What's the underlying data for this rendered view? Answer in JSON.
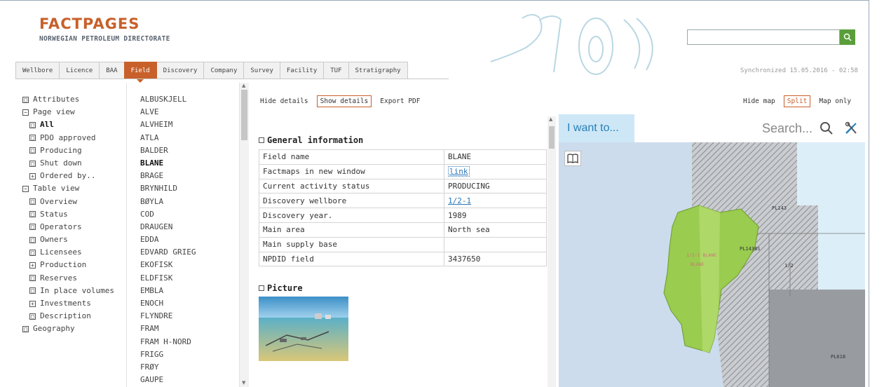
{
  "header": {
    "title": "FACTPAGES",
    "subtitle": "NORWEGIAN PETROLEUM DIRECTORATE",
    "search_placeholder": "",
    "sync_text": "Synchronized 15.05.2016 - 02:58"
  },
  "tabs": [
    {
      "label": "Wellbore"
    },
    {
      "label": "Licence"
    },
    {
      "label": "BAA"
    },
    {
      "label": "Field",
      "active": true
    },
    {
      "label": "Discovery"
    },
    {
      "label": "Company"
    },
    {
      "label": "Survey"
    },
    {
      "label": "Facility"
    },
    {
      "label": "TUF"
    },
    {
      "label": "Stratigraphy"
    }
  ],
  "tree": [
    {
      "label": "Attributes",
      "level": 0,
      "box": "□"
    },
    {
      "label": "Page view",
      "level": 0,
      "box": "−"
    },
    {
      "label": "All",
      "level": 1,
      "box": "□",
      "bold": true
    },
    {
      "label": "PDO approved",
      "level": 1,
      "box": "□"
    },
    {
      "label": "Producing",
      "level": 1,
      "box": "□"
    },
    {
      "label": "Shut down",
      "level": 1,
      "box": "□"
    },
    {
      "label": "Ordered by..",
      "level": 1,
      "box": "+"
    },
    {
      "label": "Table view",
      "level": 0,
      "box": "−"
    },
    {
      "label": "Overview",
      "level": 1,
      "box": "□"
    },
    {
      "label": "Status",
      "level": 1,
      "box": "□"
    },
    {
      "label": "Operators",
      "level": 1,
      "box": "□"
    },
    {
      "label": "Owners",
      "level": 1,
      "box": "□"
    },
    {
      "label": "Licensees",
      "level": 1,
      "box": "□"
    },
    {
      "label": "Production",
      "level": 1,
      "box": "+"
    },
    {
      "label": "Reserves",
      "level": 1,
      "box": "□"
    },
    {
      "label": "In place volumes",
      "level": 1,
      "box": "□"
    },
    {
      "label": "Investments",
      "level": 1,
      "box": "+"
    },
    {
      "label": "Description",
      "level": 1,
      "box": "□"
    },
    {
      "label": "Geography",
      "level": 0,
      "box": "□"
    }
  ],
  "fields": [
    "ALBUSKJELL",
    "ALVE",
    "ALVHEIM",
    "ATLA",
    "BALDER",
    "BLANE",
    "BRAGE",
    "BRYNHILD",
    "BØYLA",
    "COD",
    "DRAUGEN",
    "EDDA",
    "EDVARD GRIEG",
    "EKOFISK",
    "ELDFISK",
    "EMBLA",
    "ENOCH",
    "FLYNDRE",
    "FRAM",
    "FRAM H-NORD",
    "FRIGG",
    "FRØY",
    "GAUPE"
  ],
  "selected_field": "BLANE",
  "details_links": {
    "hide": "Hide details",
    "show": "Show details",
    "pdf": "Export PDF"
  },
  "general": {
    "heading": "General information",
    "rows": [
      {
        "key": "Field name",
        "value": "BLANE"
      },
      {
        "key": "Factmaps in new window",
        "value": "link",
        "link": true,
        "boxed": true
      },
      {
        "key": "Current activity status",
        "value": "PRODUCING"
      },
      {
        "key": "Discovery wellbore",
        "value": "1/2-1",
        "link": true
      },
      {
        "key": "Discovery year.",
        "value": "1989"
      },
      {
        "key": "Main area",
        "value": "North sea"
      },
      {
        "key": "Main supply base",
        "value": ""
      },
      {
        "key": "NPDID field",
        "value": "3437650"
      }
    ]
  },
  "picture": {
    "heading": "Picture"
  },
  "map_links": {
    "hide": "Hide map",
    "split": "Split",
    "only": "Map only"
  },
  "map": {
    "i_want": "I want to...",
    "search_placeholder": "Search...",
    "labels": {
      "pl143": "PL143",
      "blane_code": "1/2-1 BLANE",
      "blane": "BLANE",
      "pl143bs": "PL143BS",
      "l1c": "1/2",
      "pl618": "PL618"
    }
  }
}
